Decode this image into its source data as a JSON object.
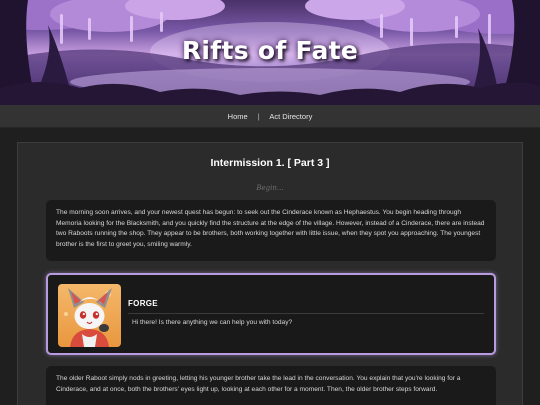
{
  "site": {
    "title": "Rifts of Fate"
  },
  "nav": {
    "items": [
      {
        "label": "Home"
      },
      {
        "label": "Act Directory"
      }
    ],
    "separator": "|"
  },
  "chapter": {
    "title": "Intermission 1. [ Part 3 ]",
    "begin_label": "Begin..."
  },
  "paragraphs": [
    "The morning soon arrives, and your newest quest has begun: to seek out the Cinderace known as Hephaestus. You begin heading through Memoria looking for the Blacksmith, and you quickly find the structure at the edge of the village. However, instead of a Cinderace, there are instead two Raboots running the shop. They appear to be brothers, both working together with little issue, when they spot you approaching. The youngest brother is the first to greet you, smiling warmly.",
    "The older Raboot simply nods in greeting, letting his younger brother take the lead in the conversation. You explain that you're looking for a Cinderace, and at once, both the brothers' eyes light up, looking at each other for a moment. Then, the older brother steps forward."
  ],
  "dialogue": {
    "speaker": "FORGE",
    "line": "Hi there! Is there anything we can help you with today?",
    "border_color": "#b79ae0",
    "portrait_icon": "raboot-portrait"
  },
  "colors": {
    "background": "#1f1f1f",
    "panel": "#2b2b2b",
    "text_box": "#1a1a1a",
    "accent": "#b79ae0"
  }
}
